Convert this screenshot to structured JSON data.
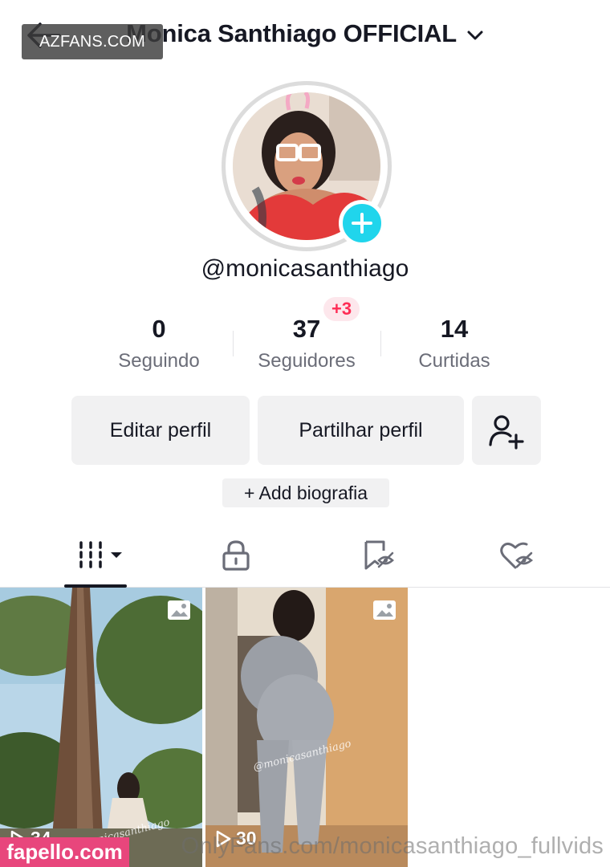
{
  "header": {
    "title": "Monica Santhiago OFFICIAL",
    "back_icon": "arrow-left-icon",
    "dropdown_icon": "chevron-down-icon"
  },
  "watermarks": {
    "top": "AZFANS.COM",
    "bottom_left": "fapello.com",
    "bottom_right": "OnlyFans.com/monicasanthiago_fullvids"
  },
  "profile": {
    "username": "@monicasanthiago",
    "add_icon": "plus-icon"
  },
  "stats": [
    {
      "value": "0",
      "label": "Seguindo"
    },
    {
      "value": "37",
      "label": "Seguidores",
      "badge": "+3"
    },
    {
      "value": "14",
      "label": "Curtidas"
    }
  ],
  "actions": {
    "edit_label": "Editar perfil",
    "share_label": "Partilhar perfil",
    "add_friend_icon": "add-user-icon",
    "bio_label": "+ Add biografia"
  },
  "tabs": [
    {
      "icon": "grid-videos-icon",
      "selected": true
    },
    {
      "icon": "lock-icon",
      "selected": false
    },
    {
      "icon": "bookmark-hidden-icon",
      "selected": false
    },
    {
      "icon": "liked-hidden-icon",
      "selected": false
    }
  ],
  "videos": [
    {
      "views": "34",
      "signature": "@monicasanthiago",
      "type_icon": "photo-icon"
    },
    {
      "views": "30",
      "signature": "@monicasanthiago",
      "type_icon": "photo-icon"
    }
  ],
  "colors": {
    "accent_cyan": "#20d5ec",
    "badge_red": "#fe2c55",
    "button_bg": "#f1f1f2",
    "watermark_pink": "#e8467c"
  }
}
